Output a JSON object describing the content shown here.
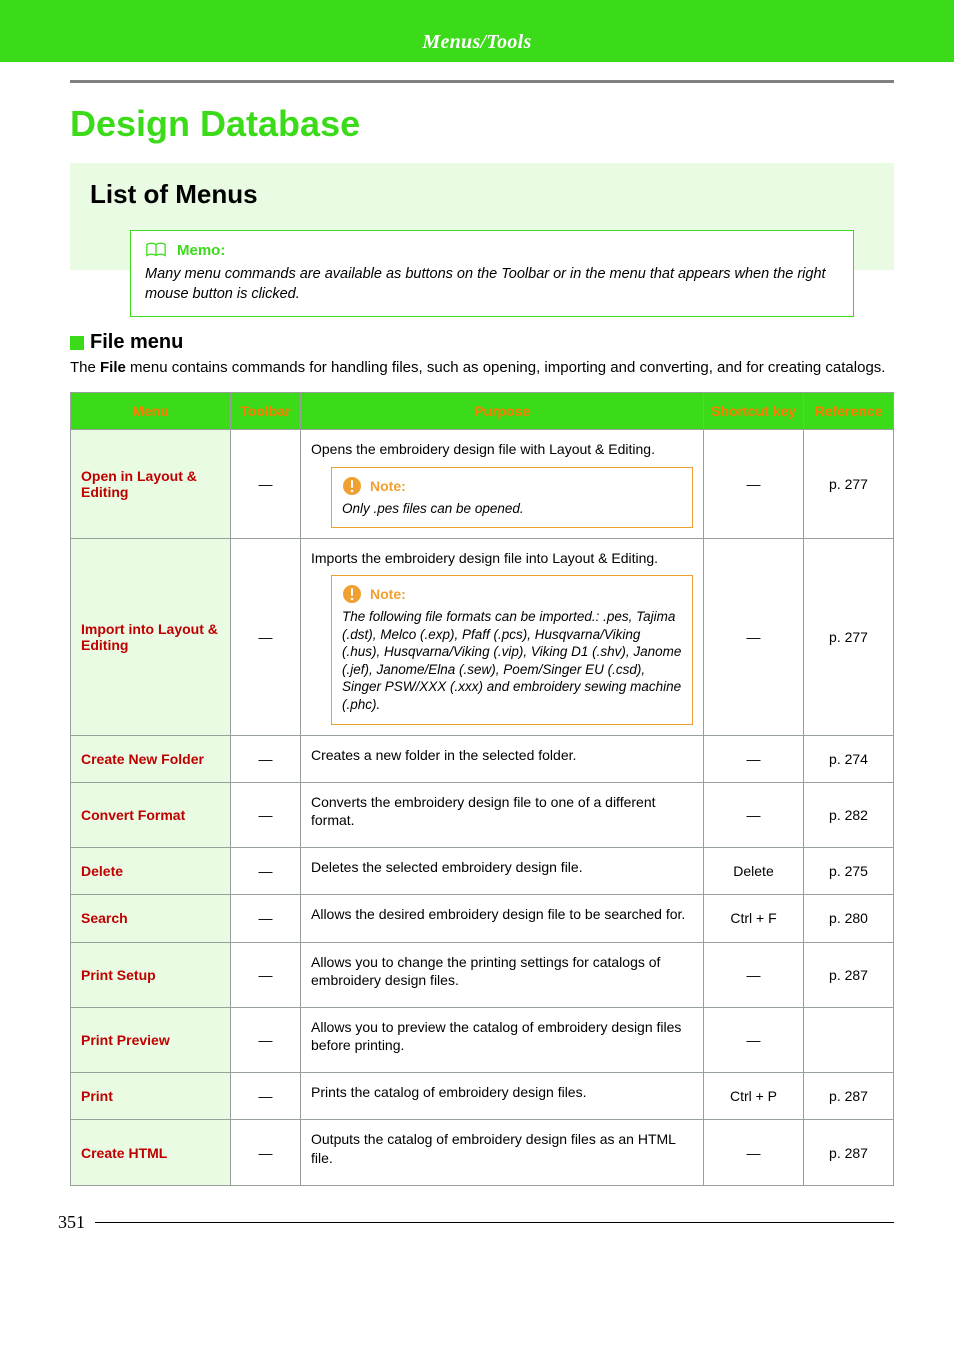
{
  "header": {
    "tab": "Menus/Tools"
  },
  "title": "Design Database",
  "subhead": "List of Menus",
  "memo": {
    "label": "Memo:",
    "text": "Many menu commands are available as buttons on the Toolbar or in the menu that appears when the right mouse button is clicked."
  },
  "section": {
    "title": "File menu",
    "desc_pre": "The ",
    "desc_bold": "File",
    "desc_post": " menu contains commands for handling files, such as opening, importing and converting, and for creating catalogs."
  },
  "table": {
    "headers": {
      "menu": "Menu",
      "toolbar": "Toolbar",
      "purpose": "Purpose",
      "shortcut": "Shortcut key",
      "reference": "Reference"
    },
    "dash": "—",
    "note_label": "Note:",
    "rows": [
      {
        "menu": "Open in Layout & Editing",
        "toolbar": "—",
        "purpose": "Opens the embroidery design file with Layout & Editing.",
        "note": "Only .pes files can be opened.",
        "shortcut": "—",
        "reference": "p. 277"
      },
      {
        "menu": "Import into Layout & Editing",
        "toolbar": "—",
        "purpose": "Imports the embroidery design file into Layout & Editing.",
        "note": "The following file formats can be imported.: .pes, Tajima (.dst), Melco (.exp), Pfaff (.pcs), Husqvarna/Viking (.hus), Husqvarna/Viking (.vip), Viking D1 (.shv), Janome (.jef), Janome/Elna (.sew), Poem/Singer EU (.csd), Singer PSW/XXX (.xxx) and embroidery sewing machine (.phc).",
        "shortcut": "—",
        "reference": "p. 277"
      },
      {
        "menu": "Create New Folder",
        "toolbar": "—",
        "purpose": "Creates a new folder in the selected folder.",
        "shortcut": "—",
        "reference": "p. 274"
      },
      {
        "menu": "Convert Format",
        "toolbar": "—",
        "purpose": "Converts the embroidery design file to one of a different format.",
        "shortcut": "—",
        "reference": "p. 282"
      },
      {
        "menu": "Delete",
        "toolbar": "—",
        "purpose": "Deletes the selected embroidery design file.",
        "shortcut": "Delete",
        "reference": "p. 275"
      },
      {
        "menu": "Search",
        "toolbar": "—",
        "purpose": "Allows the desired embroidery design file to be searched for.",
        "shortcut": "Ctrl + F",
        "reference": "p. 280"
      },
      {
        "menu": "Print Setup",
        "toolbar": "—",
        "purpose": "Allows you to change the printing settings for catalogs of embroidery design files.",
        "shortcut": "—",
        "reference": "p. 287"
      },
      {
        "menu": "Print Preview",
        "toolbar": "—",
        "purpose": "Allows you to preview the catalog of embroidery design files before printing.",
        "shortcut": "—",
        "reference": ""
      },
      {
        "menu": "Print",
        "toolbar": "—",
        "purpose": "Prints the catalog of embroidery design files.",
        "shortcut": "Ctrl + P",
        "reference": "p. 287"
      },
      {
        "menu": "Create HTML",
        "toolbar": "—",
        "purpose": "Outputs the catalog of embroidery design files as an HTML file.",
        "shortcut": "—",
        "reference": "p. 287"
      }
    ]
  },
  "footer": {
    "page": "351"
  }
}
